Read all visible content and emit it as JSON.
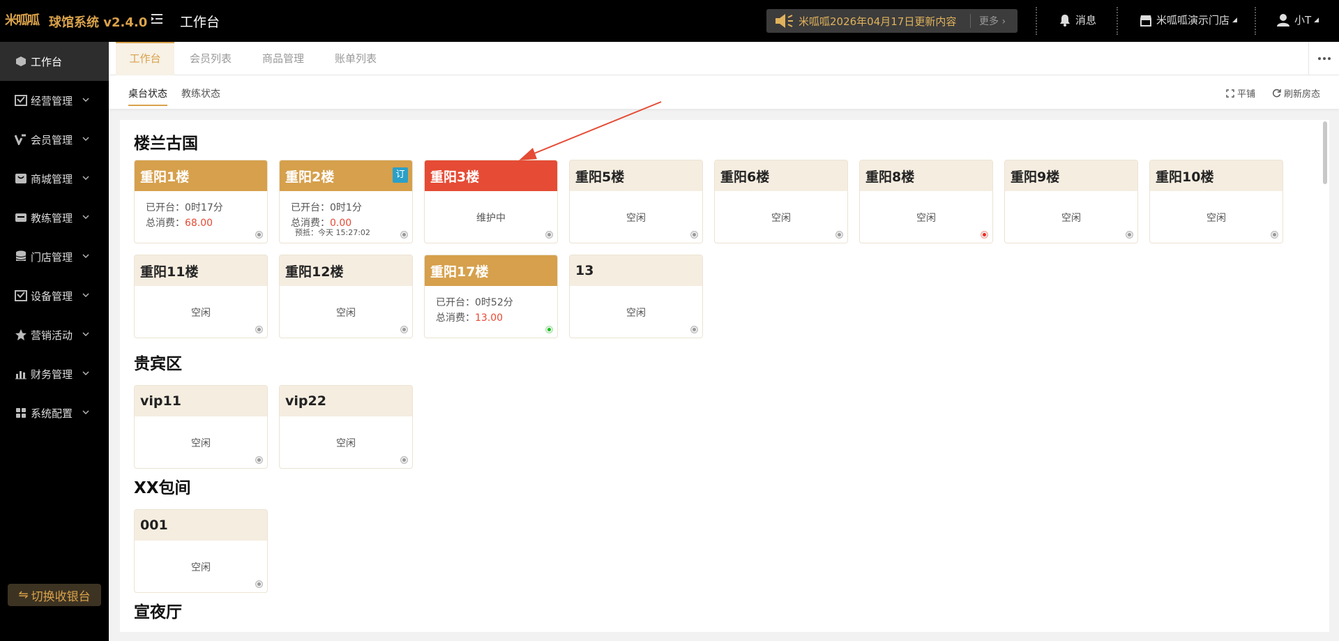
{
  "header": {
    "logo_text": "米呱呱",
    "app_name": "球馆系统 v2.4.0",
    "page_title": "工作台",
    "notice": "米呱呱2026年04月17日更新内容",
    "notice_more": "更多",
    "messages": "消息",
    "store": "米呱呱演示门店",
    "user": "小T"
  },
  "sidebar": {
    "items": [
      {
        "label": "工作台",
        "icon": "cube-icon"
      },
      {
        "label": "经营管理",
        "icon": "store-icon"
      },
      {
        "label": "会员管理",
        "icon": "vip-icon"
      },
      {
        "label": "商城管理",
        "icon": "mall-icon"
      },
      {
        "label": "教练管理",
        "icon": "coach-icon"
      },
      {
        "label": "门店管理",
        "icon": "database-icon"
      },
      {
        "label": "设备管理",
        "icon": "device-icon"
      },
      {
        "label": "营销活动",
        "icon": "star-icon"
      },
      {
        "label": "财务管理",
        "icon": "chart-icon"
      },
      {
        "label": "系统配置",
        "icon": "grid-icon"
      }
    ],
    "switch_label": "切换收银台"
  },
  "tabs": [
    "工作台",
    "会员列表",
    "商品管理",
    "账单列表"
  ],
  "subtabs": [
    "桌台状态",
    "教练状态"
  ],
  "actions": {
    "tile": "平铺",
    "refresh": "刷新房态"
  },
  "areas": [
    {
      "name": "楼兰古国",
      "tables": [
        {
          "name": "重阳1楼",
          "state": "busy",
          "open_label": "已开台：",
          "open_time": "0时17分",
          "spend_label": "总消费：",
          "spend": "68.00",
          "dot": "gray"
        },
        {
          "name": "重阳2楼",
          "state": "busy",
          "badge": "订",
          "open_label": "已开台：",
          "open_time": "0时1分",
          "spend_label": "总消费：",
          "spend": "0.00",
          "reserve": "预抵：今天 15:27:02",
          "dot": "gray"
        },
        {
          "name": "重阳3楼",
          "state": "maint",
          "status": "维护中",
          "dot": "gray"
        },
        {
          "name": "重阳5楼",
          "state": "idle",
          "status": "空闲",
          "dot": "gray"
        },
        {
          "name": "重阳6楼",
          "state": "idle",
          "status": "空闲",
          "dot": "gray"
        },
        {
          "name": "重阳8楼",
          "state": "idle",
          "status": "空闲",
          "dot": "red"
        },
        {
          "name": "重阳9楼",
          "state": "idle",
          "status": "空闲",
          "dot": "gray"
        },
        {
          "name": "重阳10楼",
          "state": "idle",
          "status": "空闲",
          "dot": "gray"
        },
        {
          "name": "重阳11楼",
          "state": "idle",
          "status": "空闲",
          "dot": "gray"
        },
        {
          "name": "重阳12楼",
          "state": "idle",
          "status": "空闲",
          "dot": "gray"
        },
        {
          "name": "重阳17楼",
          "state": "busy",
          "open_label": "已开台：",
          "open_time": "0时52分",
          "spend_label": "总消费：",
          "spend": "13.00",
          "dot": "green"
        },
        {
          "name": "13",
          "state": "idle",
          "status": "空闲",
          "dot": "gray"
        }
      ]
    },
    {
      "name": "贵宾区",
      "tables": [
        {
          "name": "vip11",
          "state": "idle",
          "status": "空闲",
          "dot": "gray"
        },
        {
          "name": "vip22",
          "state": "idle",
          "status": "空闲",
          "dot": "gray"
        }
      ]
    },
    {
      "name": "XX包间",
      "tables": [
        {
          "name": "001",
          "state": "idle",
          "status": "空闲",
          "dot": "gray"
        }
      ]
    },
    {
      "name": "宣夜厅",
      "tables": []
    }
  ],
  "colors": {
    "accent": "#d9a24b",
    "busy": "#d6a04c",
    "maintenance": "#e54b35",
    "idle_header": "#f5ede0"
  }
}
